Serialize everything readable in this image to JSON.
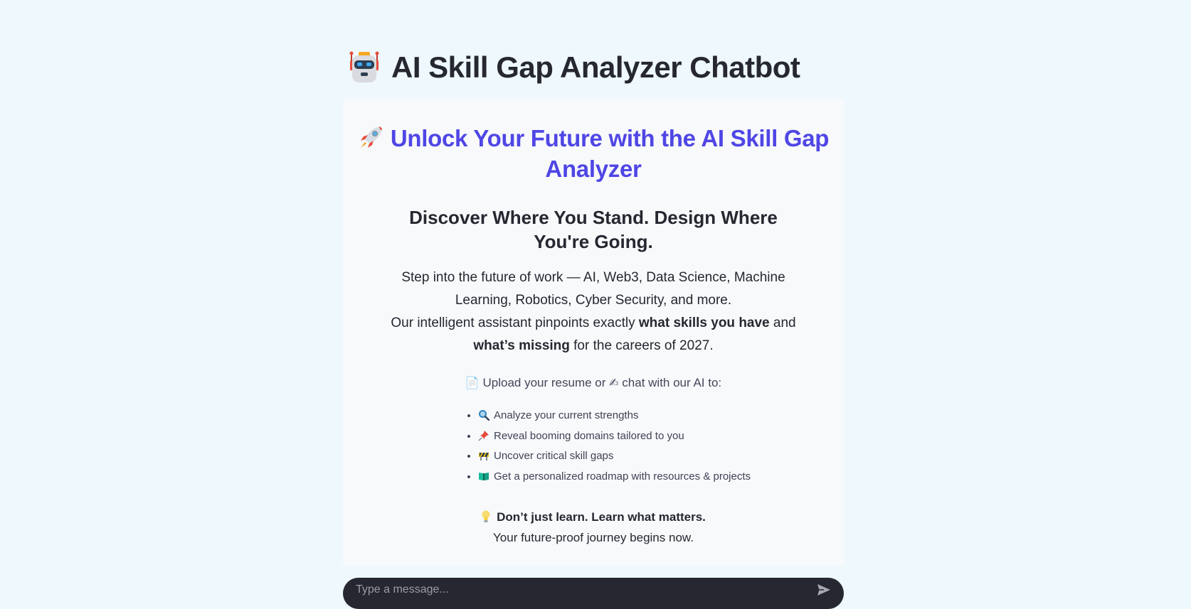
{
  "page": {
    "title": "AI Skill Gap Analyzer Chatbot",
    "title_icon": "robot-icon"
  },
  "hero": {
    "title": "Unlock Your Future with the AI Skill Gap Analyzer",
    "title_icon": "rocket-icon",
    "subtitle": "Discover Where You Stand. Design Where You're Going.",
    "body_line1": "Step into the future of work — AI, Web3, Data Science, Machine Learning, Robotics, Cyber Security, and more.",
    "body_line2_prefix": "Our intelligent assistant pinpoints exactly ",
    "body_line2_bold1": "what skills you have",
    "body_line2_mid": " and ",
    "body_line2_bold2": "what’s missing",
    "body_line2_suffix": " for the careers of 2027.",
    "upload_icon": "📄",
    "upload_text1": "Upload your resume or",
    "chat_icon": "✍",
    "upload_text2": "chat with our AI to:",
    "features": [
      {
        "icon": "magnifier-icon",
        "text": "Analyze your current strengths"
      },
      {
        "icon": "pushpin-icon",
        "text": "Reveal booming domains tailored to you"
      },
      {
        "icon": "construction-icon",
        "text": "Uncover critical skill gaps"
      },
      {
        "icon": "book-icon",
        "text": "Get a personalized roadmap with resources & projects"
      }
    ],
    "tagline_icon": "lightbulb-icon",
    "tagline_bold": "Don’t just learn. Learn what matters.",
    "tagline_sub": "Your future-proof journey begins now."
  },
  "chat": {
    "placeholder": "Type a message...",
    "send_icon": "send-icon"
  },
  "colors": {
    "page_bg": "#eef8fd",
    "card_bg": "#f7f9fb",
    "accent": "#4f46e5",
    "chat_bar": "#262730",
    "text": "#262730"
  }
}
